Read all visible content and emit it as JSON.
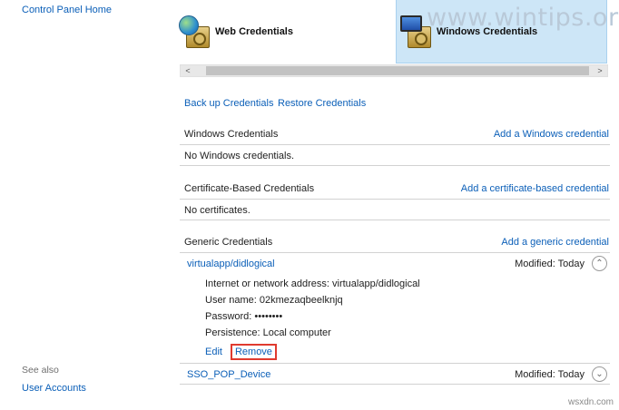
{
  "left_nav": {
    "home": "Control Panel Home",
    "see_also": "See also",
    "user_accounts": "User Accounts"
  },
  "tiles": {
    "web": "Web Credentials",
    "windows": "Windows Credentials"
  },
  "watermarks": {
    "top": "www.wintips.org",
    "bottom": "wsxdn.com"
  },
  "scrollbar": {
    "left_arrow": "<",
    "right_arrow": ">"
  },
  "actions": {
    "backup": "Back up Credentials",
    "restore": "Restore Credentials"
  },
  "sections": {
    "windows": {
      "title": "Windows Credentials",
      "add": "Add a Windows credential",
      "empty": "No Windows credentials."
    },
    "certificate": {
      "title": "Certificate-Based Credentials",
      "add": "Add a certificate-based credential",
      "empty": "No certificates."
    },
    "generic": {
      "title": "Generic Credentials",
      "add": "Add a generic credential"
    }
  },
  "generic_items": [
    {
      "name": "virtualapp/didlogical",
      "modified": "Modified:  Today",
      "expanded": true,
      "details": {
        "address": "Internet or network address:  virtualapp/didlogical",
        "user": "User name:  02kmezaqbeelknjq",
        "password": "Password:  ••••••••",
        "persistence": "Persistence:  Local computer"
      },
      "edit": "Edit",
      "remove": "Remove"
    },
    {
      "name": "SSO_POP_Device",
      "modified": "Modified:  Today",
      "expanded": false
    }
  ],
  "icons": {
    "expanded": "⌃",
    "collapsed": "⌄"
  },
  "colors": {
    "link": "#0b5fb8",
    "selected_tile": "#cde6f7",
    "highlight_box": "#e03a2f"
  }
}
